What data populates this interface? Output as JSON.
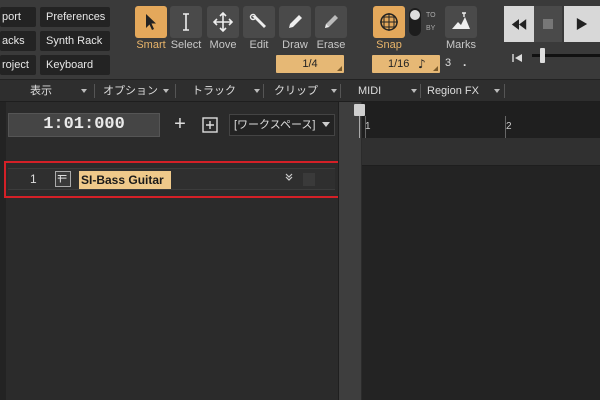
{
  "toolbar": {
    "left_buttons": {
      "export": "port",
      "tracks": "acks",
      "project": "roject",
      "preferences": "Preferences",
      "synth_rack": "Synth Rack",
      "keyboard": "Keyboard"
    },
    "tools": {
      "smart": "Smart",
      "select": "Select",
      "move": "Move",
      "edit": "Edit",
      "draw": "Draw",
      "erase": "Erase"
    },
    "snap_label": "Snap",
    "marks_label": "Marks",
    "draw_resolution": "1/4",
    "snap_resolution": "1/16",
    "snap_to": "TO",
    "snap_by": "BY",
    "triplet_value": "3",
    "dot_value": "."
  },
  "menubar": {
    "items": [
      "表示",
      "オプション",
      "トラック",
      "クリップ",
      "MIDI",
      "Region FX"
    ]
  },
  "track_pane": {
    "time": "1:01:000",
    "workspace": "[ワークスペース]"
  },
  "tracks": [
    {
      "number": "1",
      "name": "SI-Bass Guitar"
    }
  ],
  "ruler": {
    "bars": [
      "1",
      "2"
    ]
  },
  "colors": {
    "accent": "#e4a85b",
    "track_name_bg": "#efc98a",
    "highlight": "#d42027"
  }
}
